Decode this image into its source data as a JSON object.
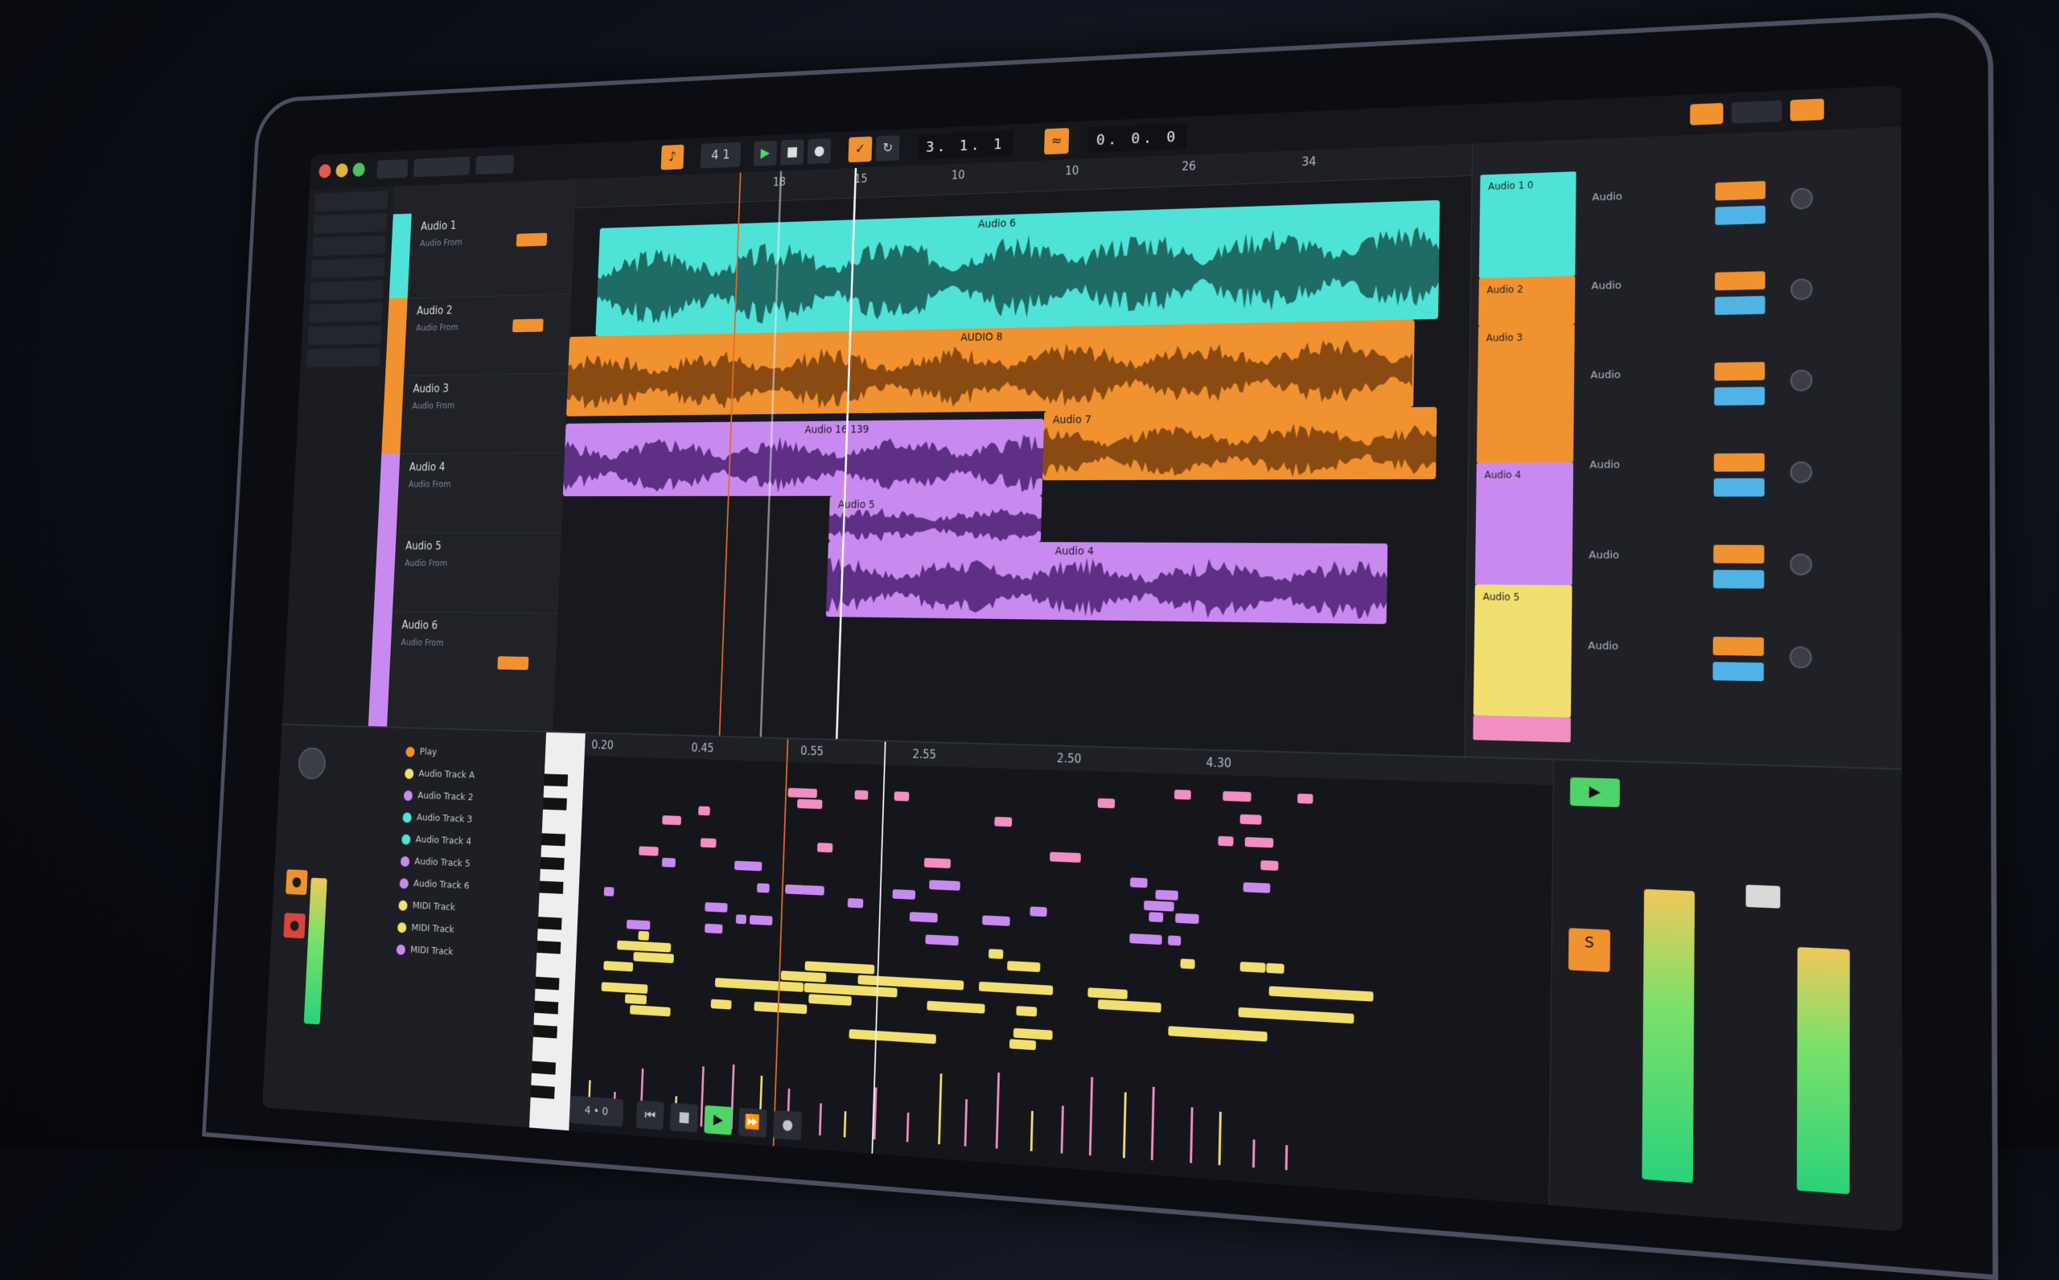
{
  "colors": {
    "cyan": "#4ee3d6",
    "orange": "#f0922f",
    "violet": "#c98af0",
    "yellow": "#f1e070",
    "pink": "#f28ec2",
    "green": "#4fd36b",
    "accent": "#f0922f"
  },
  "transport": {
    "position": "3. 1. 1",
    "tempo_readout": "0. 0. 0",
    "play_icon": "play-icon",
    "stop_icon": "stop-icon",
    "record_icon": "record-icon"
  },
  "ruler": {
    "ticks": [
      "18",
      "15",
      "10",
      "10",
      "26",
      "34"
    ]
  },
  "bottom_ruler": {
    "ticks": [
      "0.20",
      "0.45",
      "0.55",
      "2.55",
      "2.50",
      "4.30"
    ]
  },
  "clips": {
    "cyan_label": "Audio 6",
    "orange_label_1": "AUDIO 8",
    "orange_label_2": "Audio 7",
    "violet_label_1": "Audio 16 139",
    "violet_label_2": "Audio 5",
    "violet_label_3": "Audio 4"
  },
  "tracks": [
    {
      "name": "Audio 1",
      "sub": "Audio From",
      "color": "cyan"
    },
    {
      "name": "Audio 2",
      "sub": "Audio From",
      "color": "orange"
    },
    {
      "name": "Audio 3",
      "sub": "Audio From",
      "color": "orange"
    },
    {
      "name": "Audio 4",
      "sub": "Audio From",
      "color": "violet"
    },
    {
      "name": "Audio 5",
      "sub": "Audio From",
      "color": "violet"
    },
    {
      "name": "Audio 6",
      "sub": "Audio From",
      "color": "violet"
    }
  ],
  "session": {
    "cell1": "Audio 1 0",
    "cell2": "Audio 2",
    "cell3": "Audio 3",
    "cell4": "Audio 4",
    "cell5": "Audio 5"
  },
  "mixer_rows": [
    "Audio",
    "Audio",
    "Audio",
    "Audio",
    "Audio",
    "Audio"
  ],
  "tracklist": [
    {
      "name": "Play",
      "color": "orange"
    },
    {
      "name": "Audio Track A",
      "color": "yellow"
    },
    {
      "name": "Audio Track 2",
      "color": "violet"
    },
    {
      "name": "Audio Track 3",
      "color": "cyan"
    },
    {
      "name": "Audio Track 4",
      "color": "cyan"
    },
    {
      "name": "Audio Track 5",
      "color": "violet"
    },
    {
      "name": "Audio Track 6",
      "color": "violet"
    },
    {
      "name": "MIDI Track",
      "color": "yellow"
    },
    {
      "name": "MIDI Track",
      "color": "yellow"
    },
    {
      "name": "MIDI Track",
      "color": "violet"
    }
  ],
  "bottom_transport": {
    "position": "4 • 0"
  }
}
